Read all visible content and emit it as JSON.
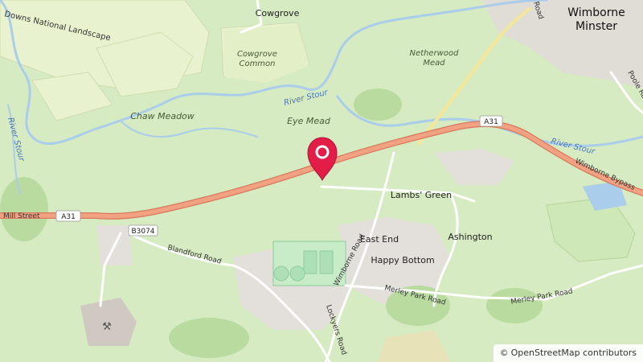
{
  "map": {
    "places": {
      "wimborne_1": "Wimborne",
      "wimborne_2": "Minster",
      "cowgrove": "Cowgrove",
      "cowgrove_common_1": "Cowgrove",
      "cowgrove_common_2": "Common",
      "netherwood_1": "Netherwood",
      "netherwood_2": "Mead",
      "chaw_meadow": "Chaw Meadow",
      "eye_mead": "Eye Mead",
      "lambs_green": "Lambs' Green",
      "east_end": "East End",
      "ashington": "Ashington",
      "happy_bottom": "Happy Bottom",
      "downs_landscape": "Downs National Landscape"
    },
    "water": {
      "river_stour_1": "River Stour",
      "river_stour_2": "River Stour",
      "river_stour_3": "River Stour"
    },
    "roads": {
      "mill_street": "Mill Street",
      "blandford_road": "Blandford Road",
      "wimborne_road": "Wimborne Road",
      "merley_park_road_1": "Merley Park Road",
      "merley_park_road_2": "Merley Park Road",
      "wimborne_bypass": "Wimborne Bypass",
      "lockyers_road": "Lockyers Road",
      "poole_road": "Poole Ro",
      "road_fragment": "Road"
    },
    "shields": {
      "a31_west": "A31",
      "a31_east": "A31",
      "b3074": "B3074"
    },
    "marker_icon": "location-pin-icon",
    "colors": {
      "trunk_road": "#f0a283",
      "trunk_casing": "#d9785a",
      "river": "#a9cdea",
      "marker": "#e11d48"
    }
  },
  "attribution": {
    "symbol": "©",
    "text": "OpenStreetMap contributors"
  }
}
